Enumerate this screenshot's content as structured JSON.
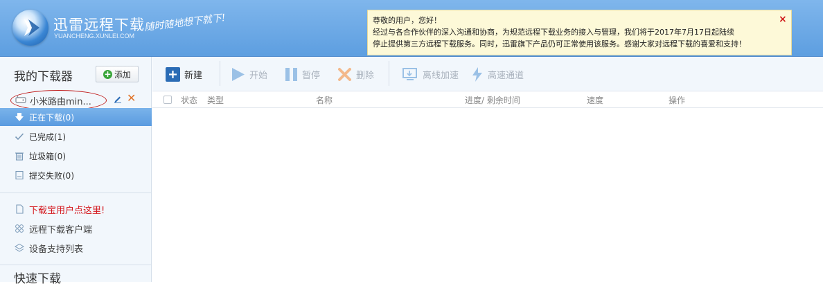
{
  "header": {
    "brand_title": "迅雷远程下载",
    "brand_sub": "YUANCHENG.XUNLEI.COM",
    "slogan": "随时随地想下就下!",
    "notice": {
      "line1": "尊敬的用户，您好！",
      "line2": "经过与各合作伙伴的深入沟通和协商，为规范远程下载业务的接入与管理，我们将于2017年7月17日起陆续",
      "line3": "停止提供第三方远程下载服务。同时，迅雷旗下产品仍可正常使用该服务。感谢大家对远程下载的喜爱和支持！",
      "close_label": "×"
    }
  },
  "sidebar": {
    "title": "我的下载器",
    "add_label": "添加",
    "device_name": "小米路由min...",
    "nav": [
      {
        "label": "正在下载(0)",
        "icon": "download-arrow-icon",
        "active": true
      },
      {
        "label": "已完成(1)",
        "icon": "check-icon",
        "active": false
      },
      {
        "label": "垃圾箱(0)",
        "icon": "trash-icon",
        "active": false
      },
      {
        "label": "提交失败(0)",
        "icon": "failed-doc-icon",
        "active": false
      }
    ],
    "links": [
      {
        "label": "下载宝用户点这里!",
        "icon": "document-icon"
      },
      {
        "label": "远程下载客户端",
        "icon": "grid-icon"
      },
      {
        "label": "设备支持列表",
        "icon": "layers-icon"
      }
    ],
    "quick_title": "快速下载"
  },
  "toolbar": {
    "new_label": "新建",
    "start_label": "开始",
    "pause_label": "暂停",
    "delete_label": "删除",
    "offline_label": "离线加速",
    "highspeed_label": "高速通道"
  },
  "table": {
    "columns": {
      "status": "状态",
      "type": "类型",
      "name": "名称",
      "progress": "进度/ 剩余时间",
      "speed": "速度",
      "actions": "操作"
    }
  },
  "colors": {
    "header_blue": "#5d9ee0",
    "active_nav": "#5a9be0",
    "notice_bg": "#fdf9d8",
    "link_red": "#d4161c"
  }
}
